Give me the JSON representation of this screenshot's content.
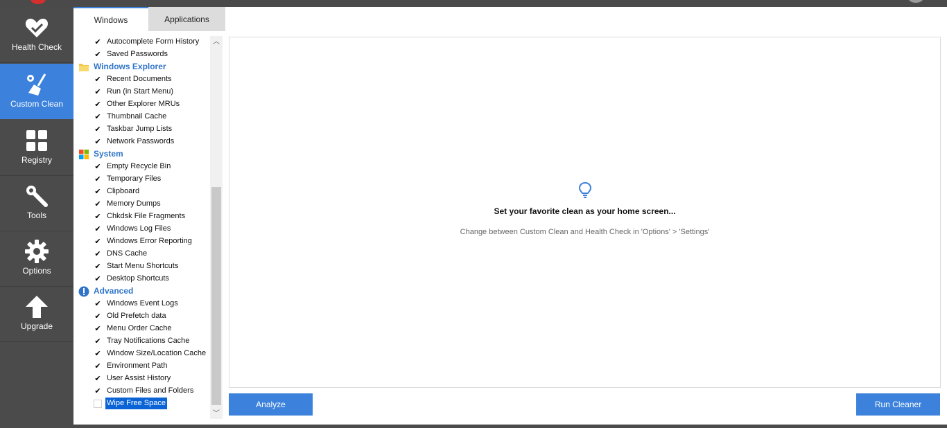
{
  "nav": {
    "items": [
      {
        "label": "Health Check",
        "icon": "heart-check-icon",
        "active": false
      },
      {
        "label": "Custom Clean",
        "icon": "broom-gear-icon",
        "active": true
      },
      {
        "label": "Registry",
        "icon": "grid-icon",
        "active": false
      },
      {
        "label": "Tools",
        "icon": "wrench-icon",
        "active": false
      },
      {
        "label": "Options",
        "icon": "gear-icon",
        "active": false
      },
      {
        "label": "Upgrade",
        "icon": "arrow-up-icon",
        "active": false
      }
    ]
  },
  "tabs": [
    {
      "label": "Windows",
      "selected": true
    },
    {
      "label": "Applications",
      "selected": false
    }
  ],
  "tree": {
    "rows": [
      {
        "type": "item",
        "label": "Autocomplete Form History",
        "checked": true
      },
      {
        "type": "item",
        "label": "Saved Passwords",
        "checked": true
      },
      {
        "type": "header",
        "label": "Windows Explorer",
        "icon": "folder-icon"
      },
      {
        "type": "item",
        "label": "Recent Documents",
        "checked": true
      },
      {
        "type": "item",
        "label": "Run (in Start Menu)",
        "checked": true
      },
      {
        "type": "item",
        "label": "Other Explorer MRUs",
        "checked": true
      },
      {
        "type": "item",
        "label": "Thumbnail Cache",
        "checked": true
      },
      {
        "type": "item",
        "label": "Taskbar Jump Lists",
        "checked": true
      },
      {
        "type": "item",
        "label": "Network Passwords",
        "checked": true
      },
      {
        "type": "header",
        "label": "System",
        "icon": "windows-logo-icon"
      },
      {
        "type": "item",
        "label": "Empty Recycle Bin",
        "checked": true
      },
      {
        "type": "item",
        "label": "Temporary Files",
        "checked": true
      },
      {
        "type": "item",
        "label": "Clipboard",
        "checked": true
      },
      {
        "type": "item",
        "label": "Memory Dumps",
        "checked": true
      },
      {
        "type": "item",
        "label": "Chkdsk File Fragments",
        "checked": true
      },
      {
        "type": "item",
        "label": "Windows Log Files",
        "checked": true
      },
      {
        "type": "item",
        "label": "Windows Error Reporting",
        "checked": true
      },
      {
        "type": "item",
        "label": "DNS Cache",
        "checked": true
      },
      {
        "type": "item",
        "label": "Start Menu Shortcuts",
        "checked": true
      },
      {
        "type": "item",
        "label": "Desktop Shortcuts",
        "checked": true
      },
      {
        "type": "header",
        "label": "Advanced",
        "icon": "exclamation-icon"
      },
      {
        "type": "item",
        "label": "Windows Event Logs",
        "checked": true
      },
      {
        "type": "item",
        "label": "Old Prefetch data",
        "checked": true
      },
      {
        "type": "item",
        "label": "Menu Order Cache",
        "checked": true
      },
      {
        "type": "item",
        "label": "Tray Notifications Cache",
        "checked": true
      },
      {
        "type": "item",
        "label": "Window Size/Location Cache",
        "checked": true
      },
      {
        "type": "item",
        "label": "Environment Path",
        "checked": true
      },
      {
        "type": "item",
        "label": "User Assist History",
        "checked": true
      },
      {
        "type": "item",
        "label": "Custom Files and Folders",
        "checked": true
      },
      {
        "type": "item",
        "label": "Wipe Free Space",
        "checked": false,
        "selected": true
      }
    ]
  },
  "main": {
    "title": "Set your favorite clean as your home screen...",
    "subtitle": "Change between Custom Clean and Health Check in 'Options' > 'Settings'",
    "analyze_label": "Analyze",
    "run_label": "Run Cleaner"
  },
  "colors": {
    "accent": "#3c82dc",
    "nav_bg": "#4b4b4b",
    "header_text": "#2f74c9"
  }
}
